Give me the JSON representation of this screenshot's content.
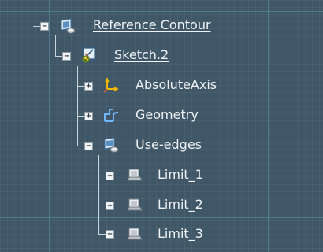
{
  "tree": {
    "nodes": [
      {
        "label": "Reference Contour",
        "icon": "part-body-icon",
        "expander": "−",
        "underlined": true
      },
      {
        "label": "Sketch.2",
        "icon": "sketch-icon",
        "expander": "−",
        "underlined": true
      },
      {
        "label": "AbsoluteAxis",
        "icon": "axis-icon",
        "expander": "+",
        "underlined": false
      },
      {
        "label": "Geometry",
        "icon": "geometry-icon",
        "expander": "+",
        "underlined": false
      },
      {
        "label": "Use-edges",
        "icon": "use-edges-icon",
        "expander": "−",
        "underlined": false
      },
      {
        "label": "Limit_1",
        "icon": "limit-icon",
        "expander": "+",
        "underlined": false
      },
      {
        "label": "Limit_2",
        "icon": "limit-icon",
        "expander": "+",
        "underlined": false
      },
      {
        "label": "Limit_3",
        "icon": "limit-icon",
        "expander": "+",
        "underlined": false
      }
    ]
  },
  "colors": {
    "background": "#3f5767",
    "text": "#eef2f4"
  }
}
